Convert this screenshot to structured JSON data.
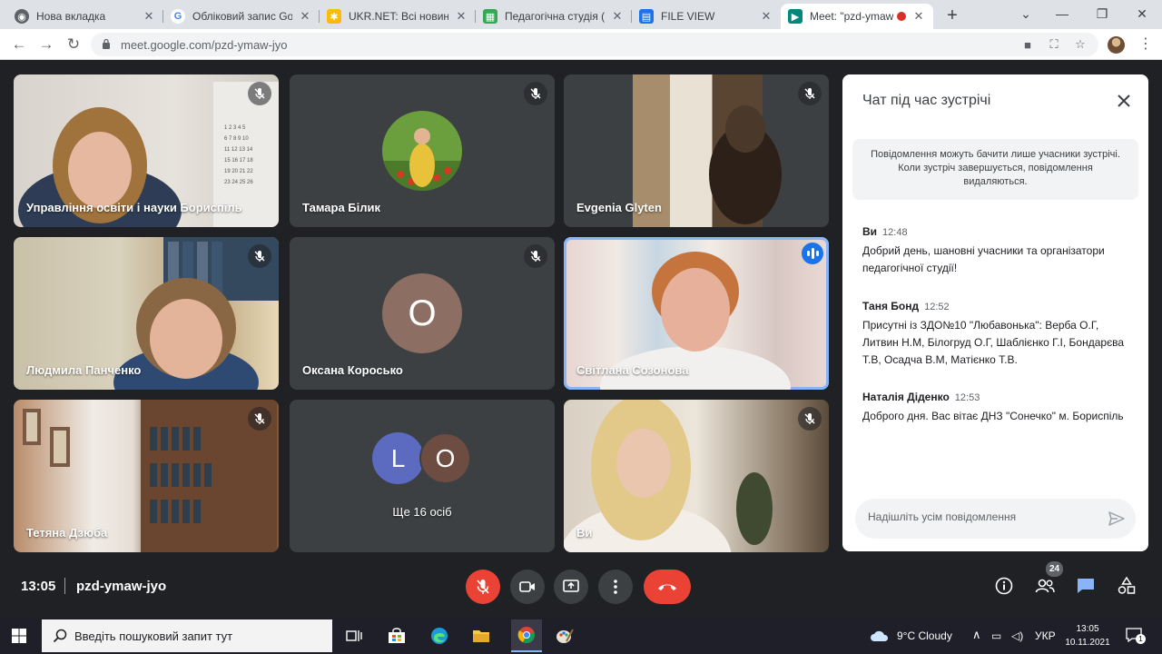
{
  "browser": {
    "tabs": [
      {
        "title": "Нова вкладка",
        "icon": "chrome-newtab-icon"
      },
      {
        "title": "Обліковий запис Goo",
        "icon": "google-icon"
      },
      {
        "title": "UKR.NET: Всі новини",
        "icon": "ukrnet-icon"
      },
      {
        "title": "Педагогічна студія (з",
        "icon": "sheets-icon"
      },
      {
        "title": "FILE VIEW",
        "icon": "docs-icon"
      },
      {
        "title": "Meet: \"pzd-ymaw",
        "icon": "meet-icon"
      }
    ],
    "url": "meet.google.com/pzd-ymaw-jyo"
  },
  "tiles": [
    {
      "name": "Управління освіти і науки Бориспіль"
    },
    {
      "name": "Тамара Білик"
    },
    {
      "name": "Evgenia Glyten"
    },
    {
      "name": "Людмила Панченко"
    },
    {
      "name": "Оксана Коросько",
      "initial": "O"
    },
    {
      "name": "Світлана Созонова"
    },
    {
      "name": "Тетяна Дзюба"
    },
    {
      "name": "Ще 16 осіб",
      "initials": [
        "L",
        "O"
      ]
    },
    {
      "name": "Ви"
    }
  ],
  "chat": {
    "title": "Чат під час зустрічі",
    "notice": "Повідомлення можуть бачити лише учасники зустрічі. Коли зустріч завершується, повідомлення видаляються.",
    "messages": [
      {
        "sender": "Ви",
        "time": "12:48",
        "text": "Добрий день, шановні учасники  та організатори педагогічної студії!"
      },
      {
        "sender": "Таня Бонд",
        "time": "12:52",
        "text": "Присутні із ЗДО№10 \"Любавонька\": Верба О.Г, Литвин Н.М, Білогруд О.Г, Шаблієнко Г.І, Бондарєва Т.В, Осадча В.М, Матієнко Т.В."
      },
      {
        "sender": "Наталія Діденко",
        "time": "12:53",
        "text": "Доброго дня. Вас вітає ДНЗ \"Сонечко\" м. Бориспіль"
      }
    ],
    "input_placeholder": "Надішліть усім повідомлення"
  },
  "meeting": {
    "time": "13:05",
    "code": "pzd-ymaw-jyo",
    "participant_count": "24"
  },
  "taskbar": {
    "search_placeholder": "Введіть пошуковий запит тут",
    "weather": "9°C  Cloudy",
    "language": "УКР",
    "time": "13:05",
    "date": "10.11.2021",
    "notifications": "1"
  },
  "colors": {
    "meet_bg": "#202124",
    "tile_bg": "#3c4043",
    "hangup_red": "#ea4335",
    "speaking_blue": "#1a73e8",
    "avatar_brown": "#8d6e63",
    "avatar_blue": "#5c6bc0"
  }
}
